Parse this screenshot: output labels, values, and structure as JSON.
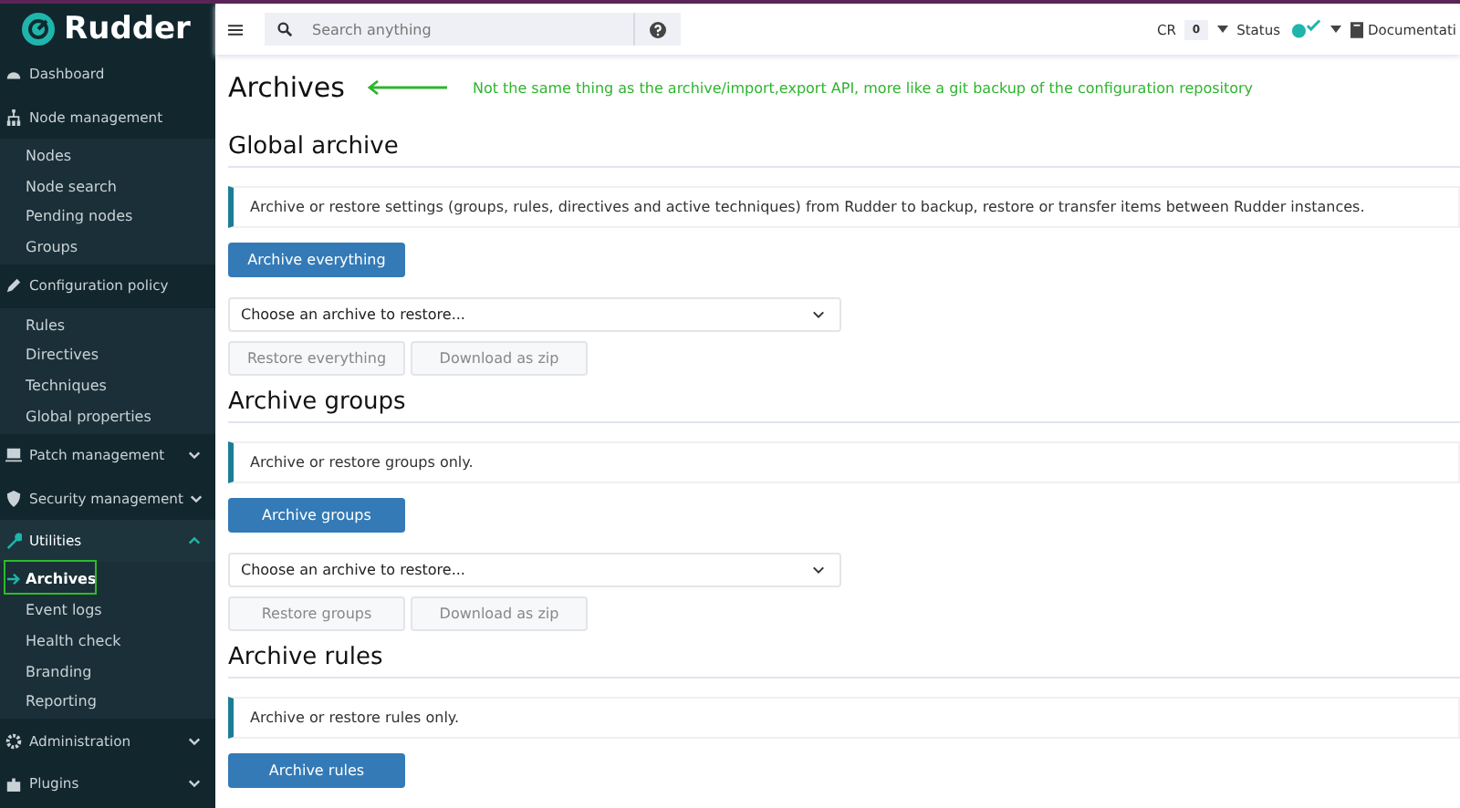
{
  "sidebar": {
    "logo": "Rudder",
    "items": [
      {
        "label": "Dashboard",
        "selected": false
      },
      {
        "label": "Node management",
        "selected": false,
        "children": [
          {
            "label": "Nodes",
            "selected": false
          },
          {
            "label": "Node search",
            "selected": false
          },
          {
            "label": "Pending nodes",
            "selected": false
          },
          {
            "label": "Groups",
            "selected": false
          }
        ]
      },
      {
        "label": "Configuration policy",
        "selected": false,
        "children": [
          {
            "label": "Rules",
            "selected": false
          },
          {
            "label": "Directives",
            "selected": false
          },
          {
            "label": "Techniques",
            "selected": false
          },
          {
            "label": "Global properties",
            "selected": false
          }
        ]
      },
      {
        "label": "Patch management",
        "selected": false,
        "expanded": false
      },
      {
        "label": "Security management",
        "selected": false,
        "expanded": false
      },
      {
        "label": "Utilities",
        "selected": true,
        "expanded": true,
        "children": [
          {
            "label": "Archives",
            "selected": true
          },
          {
            "label": "Event logs",
            "selected": false
          },
          {
            "label": "Health check",
            "selected": false
          },
          {
            "label": "Branding",
            "selected": false
          },
          {
            "label": "Reporting",
            "selected": false
          }
        ]
      },
      {
        "label": "Administration",
        "selected": false,
        "expanded": false
      },
      {
        "label": "Plugins",
        "selected": false,
        "expanded": false
      }
    ]
  },
  "top_bar": {
    "search": {
      "placeholder": "Search anything"
    },
    "cr": {
      "label": "CR",
      "count": "0"
    },
    "status": {
      "label": "Status"
    },
    "documentation": {
      "label": "Documentati"
    }
  },
  "page": {
    "title": "Archives",
    "annotation": "Not the same thing as the archive/import,export API, more like a git backup of the configuration repository"
  },
  "sections": [
    {
      "title": "Global archive",
      "description": "Archive or restore settings (groups, rules, directives and active techniques) from Rudder to backup, restore or transfer items between Rudder instances.",
      "primary_button": "Archive everything",
      "select": {
        "placeholder": "Choose an archive to restore..."
      },
      "buttons": [
        {
          "label": "Restore everything",
          "disabled": true
        },
        {
          "label": "Download as zip",
          "disabled": true
        }
      ]
    },
    {
      "title": "Archive groups",
      "description": "Archive or restore groups only.",
      "primary_button": "Archive groups",
      "select": {
        "placeholder": "Choose an archive to restore..."
      },
      "buttons": [
        {
          "label": "Restore groups",
          "disabled": true
        },
        {
          "label": "Download as zip",
          "disabled": true
        }
      ]
    },
    {
      "title": "Archive rules",
      "description": "Archive or restore rules only.",
      "primary_button": "Archive rules"
    }
  ]
}
